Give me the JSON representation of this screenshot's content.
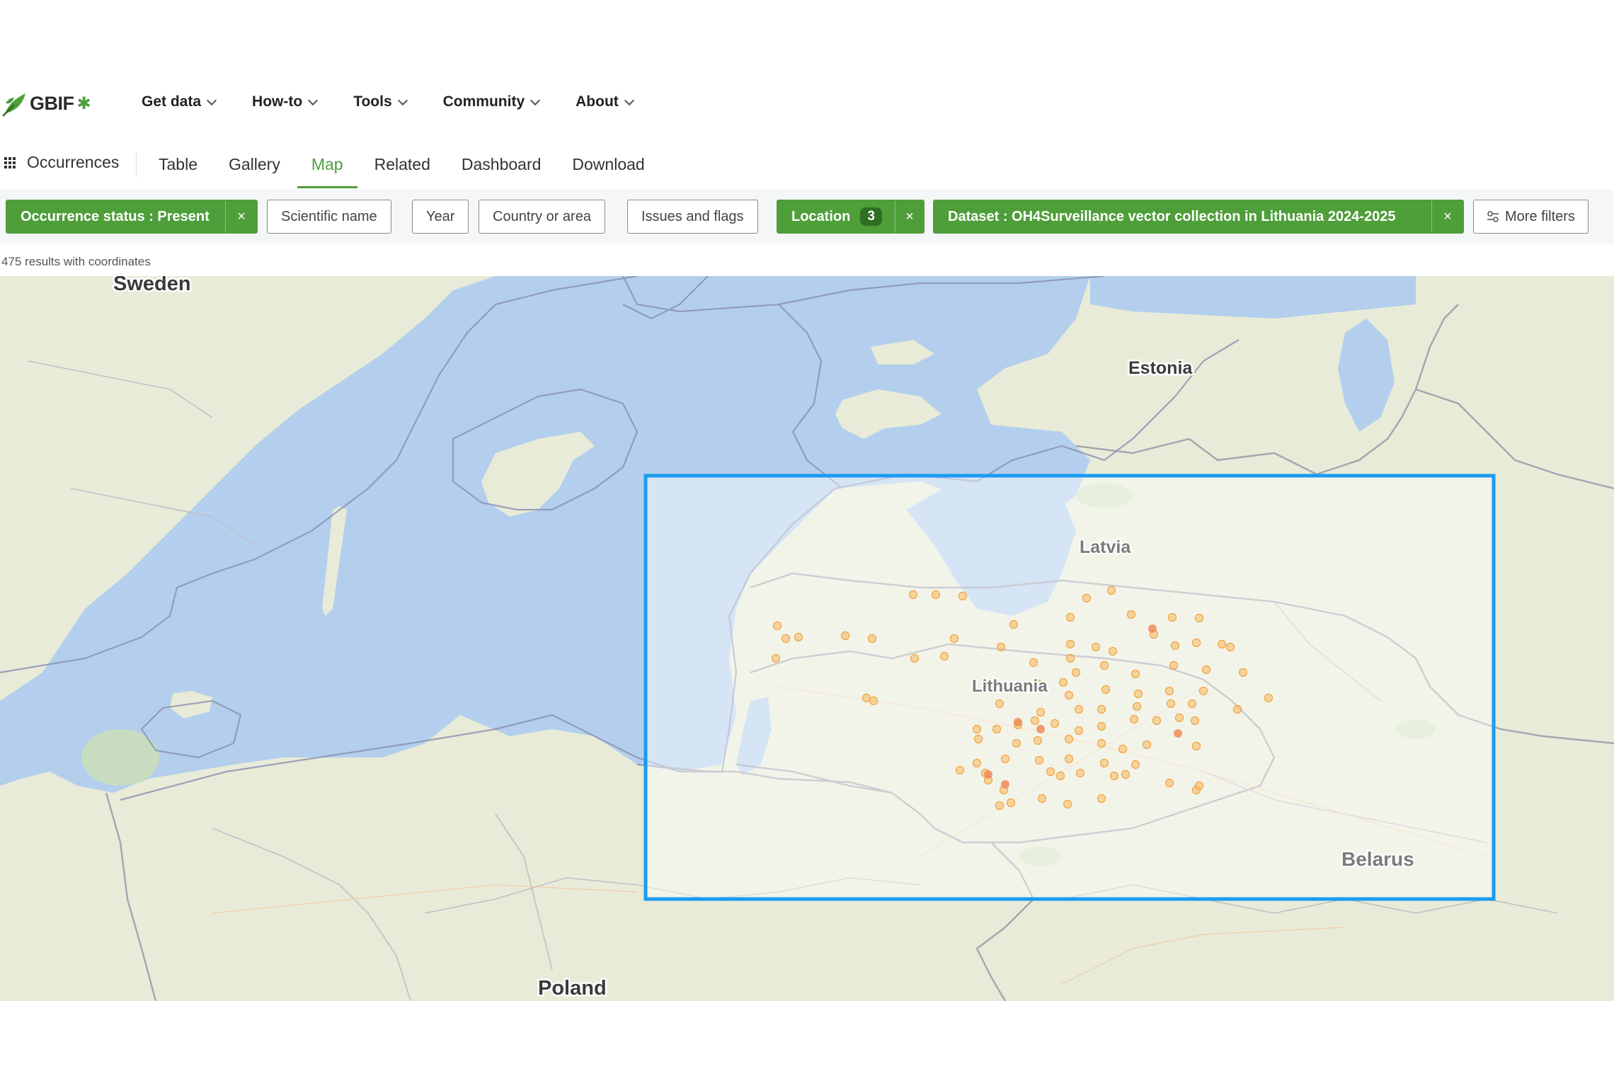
{
  "logo": {
    "wordmark": "GBIF",
    "brandmark": "✱"
  },
  "nav": {
    "items": [
      {
        "label": "Get data"
      },
      {
        "label": "How-to"
      },
      {
        "label": "Tools"
      },
      {
        "label": "Community"
      },
      {
        "label": "About"
      }
    ]
  },
  "subnav": {
    "section": "Occurrences",
    "tabs": [
      {
        "label": "Table"
      },
      {
        "label": "Gallery"
      },
      {
        "label": "Map"
      },
      {
        "label": "Related"
      },
      {
        "label": "Dashboard"
      },
      {
        "label": "Download"
      }
    ]
  },
  "filters": {
    "occurrence_status": "Occurrence status : Present",
    "scientific_name": "Scientific name",
    "year": "Year",
    "country": "Country or area",
    "issues": "Issues and flags",
    "location": "Location",
    "location_count": "3",
    "dataset": "Dataset : OH4Surveillance vector collection in Lithuania 2024-2025",
    "more": "More filters",
    "close_glyph": "×"
  },
  "results_text": "475 results with coordinates",
  "map": {
    "labels": {
      "sweden": "Sweden",
      "estonia": "Estonia",
      "latvia": "Latvia",
      "lithuania": "Lithuania",
      "belarus": "Belarus",
      "poland": "Poland"
    },
    "colors": {
      "water": "#b3cfed",
      "land": "#e8ebd7",
      "selection": "#1a9bf0",
      "point": "#f7b85f",
      "point_dense": "#ef8a5a",
      "accent": "#4e9e3a"
    }
  }
}
